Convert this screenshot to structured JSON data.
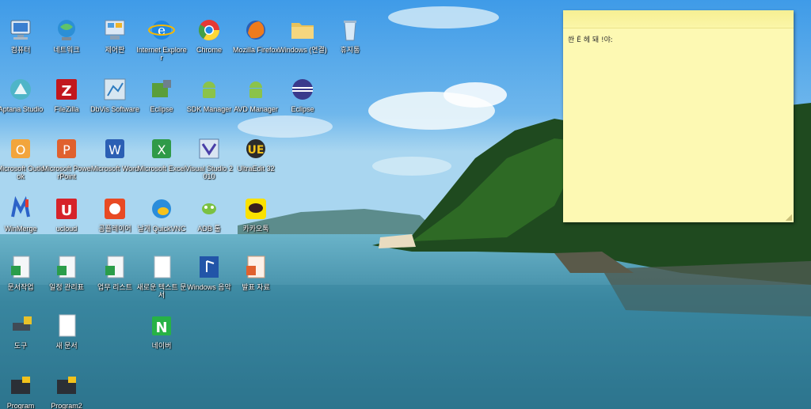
{
  "desktop": {
    "icons": [
      {
        "id": "computer",
        "label": "컴퓨터",
        "icon": "computer-icon"
      },
      {
        "id": "network",
        "label": "네트워크",
        "icon": "network-icon"
      },
      {
        "id": "control-panel",
        "label": "제어판",
        "icon": "control-panel-icon"
      },
      {
        "id": "ie",
        "label": "Internet Explorer",
        "icon": "ie-icon"
      },
      {
        "id": "chrome",
        "label": "Chrome",
        "icon": "chrome-icon"
      },
      {
        "id": "firefox",
        "label": "Mozilla Firefox",
        "icon": "firefox-icon"
      },
      {
        "id": "windows-folder",
        "label": "Windows (연결)",
        "icon": "folder-icon"
      },
      {
        "id": "recycle-bin",
        "label": "휴지통",
        "icon": "recycle-bin-icon"
      },
      {
        "id": "aptana",
        "label": "Aptana Studio",
        "icon": "aptana-icon"
      },
      {
        "id": "filezilla",
        "label": "FileZilla",
        "icon": "filezilla-icon"
      },
      {
        "id": "dbvis",
        "label": "DbVis Software",
        "icon": "dbvis-icon"
      },
      {
        "id": "eclipse-tool",
        "label": "Eclipse",
        "icon": "eclipse-tool-icon"
      },
      {
        "id": "sdk-manager",
        "label": "SDK Manager",
        "icon": "android-icon"
      },
      {
        "id": "avd-manager",
        "label": "AVD Manager",
        "icon": "android-icon"
      },
      {
        "id": "eclipse",
        "label": "Eclipse",
        "icon": "eclipse-icon"
      },
      {
        "id": "outlook",
        "label": "Microsoft Outlook",
        "icon": "outlook-icon"
      },
      {
        "id": "powerpoint",
        "label": "Microsoft PowerPoint",
        "icon": "powerpoint-icon"
      },
      {
        "id": "word",
        "label": "Microsoft Word",
        "icon": "word-icon"
      },
      {
        "id": "excel",
        "label": "Microsoft Excel",
        "icon": "excel-icon"
      },
      {
        "id": "visual-studio",
        "label": "Visual Studio 2010",
        "icon": "visual-studio-icon"
      },
      {
        "id": "ultraedit",
        "label": "UltraEdit 32",
        "icon": "ultraedit-icon"
      },
      {
        "id": "winmerge",
        "label": "WinMerge",
        "icon": "winmerge-icon"
      },
      {
        "id": "ucloud",
        "label": "ucloud",
        "icon": "ucloud-icon"
      },
      {
        "id": "photo-app",
        "label": "곰플레이어",
        "icon": "photo-app-icon"
      },
      {
        "id": "bird-app",
        "label": "날개 QuickVNC",
        "icon": "bird-app-icon"
      },
      {
        "id": "bug-app",
        "label": "ADB 툴",
        "icon": "bug-app-icon"
      },
      {
        "id": "kakaotalk",
        "label": "카카오톡",
        "icon": "kakaotalk-icon"
      },
      {
        "id": "doc1",
        "label": "문서작업",
        "icon": "doc-icon"
      },
      {
        "id": "doc2",
        "label": "일정 관리표",
        "icon": "doc-icon"
      },
      {
        "id": "doc3",
        "label": "업무 리스트",
        "icon": "doc-icon"
      },
      {
        "id": "doc4",
        "label": "새로운 텍스트 문서",
        "icon": "blank-doc-icon"
      },
      {
        "id": "music",
        "label": "Windows 음악",
        "icon": "music-icon"
      },
      {
        "id": "ppt-file",
        "label": "발표 자료",
        "icon": "ppt-file-icon"
      },
      {
        "id": "tool1",
        "label": "도구",
        "icon": "tool-icon"
      },
      {
        "id": "blank-doc",
        "label": "새 문서",
        "icon": "blank-doc-icon"
      },
      {
        "id": "naver",
        "label": "네이버",
        "icon": "naver-icon"
      },
      {
        "id": "program1",
        "label": "Program",
        "icon": "program-icon"
      },
      {
        "id": "program2",
        "label": "Program2",
        "icon": "program-icon"
      }
    ]
  },
  "sticky_note": {
    "text": "쏸 Ë 헤 돼 !야ː"
  }
}
